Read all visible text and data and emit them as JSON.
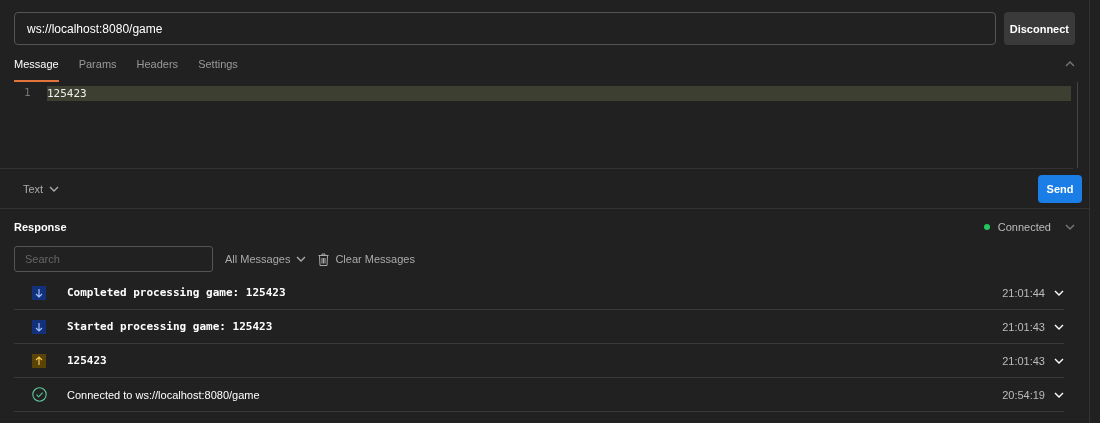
{
  "url_field": {
    "value": "ws://localhost:8080/game"
  },
  "connect_button": "Disconnect",
  "tabs": [
    {
      "label": "Message",
      "selected": true
    },
    {
      "label": "Params",
      "selected": false
    },
    {
      "label": "Headers",
      "selected": false
    },
    {
      "label": "Settings",
      "selected": false
    }
  ],
  "editor": {
    "lines": [
      {
        "number": "1",
        "text": "125423"
      }
    ]
  },
  "format_dropdown": "Text",
  "send_button": "Send",
  "response": {
    "title": "Response",
    "status": "Connected",
    "search": {
      "placeholder": "Search"
    },
    "filter": "All Messages",
    "clear": "Clear Messages",
    "messages": [
      {
        "kind": "incoming",
        "text": "Completed processing game: 125423",
        "time": "21:01:44"
      },
      {
        "kind": "incoming",
        "text": "Started processing game: 125423",
        "time": "21:01:43"
      },
      {
        "kind": "outgoing",
        "text": "125423",
        "time": "21:01:43"
      },
      {
        "kind": "connected",
        "text": "Connected to ws://localhost:8080/game",
        "time": "20:54:19"
      }
    ]
  }
}
